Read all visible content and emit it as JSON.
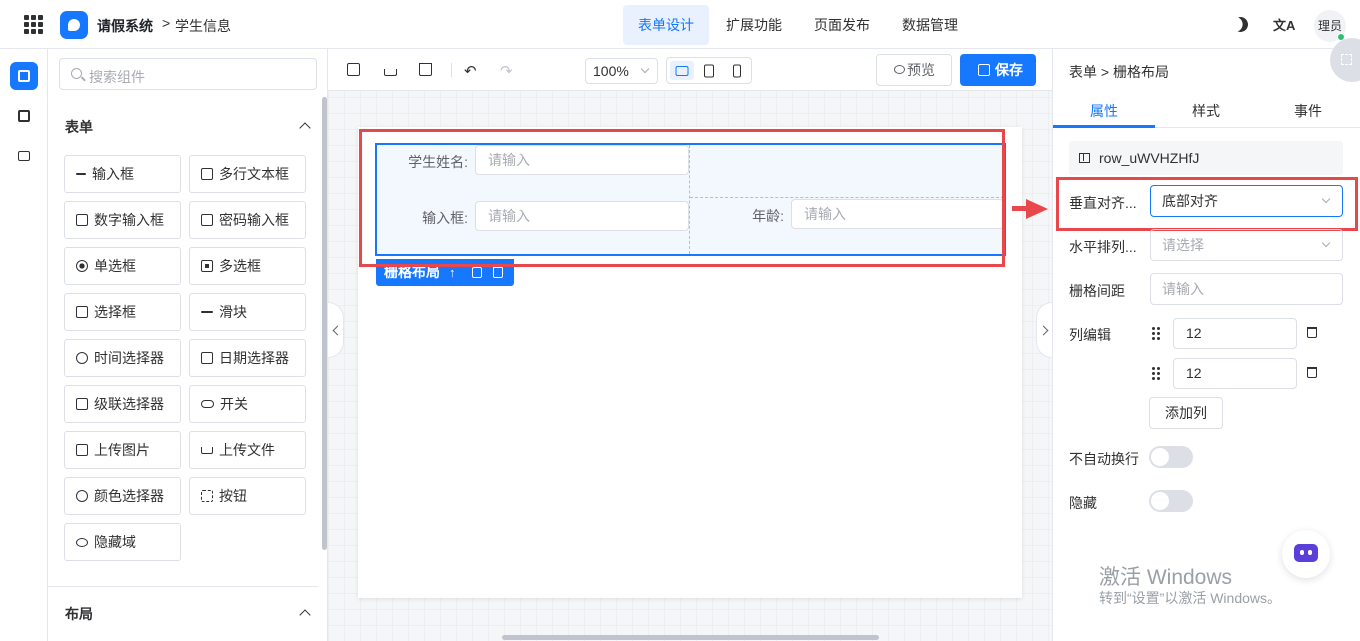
{
  "header": {
    "app_name": "请假系统",
    "breadcrumb_sep": ">",
    "page_name": "学生信息",
    "tabs": [
      {
        "label": "表单设计",
        "active": true
      },
      {
        "label": "扩展功能",
        "active": false
      },
      {
        "label": "页面发布",
        "active": false
      },
      {
        "label": "数据管理",
        "active": false
      }
    ],
    "translate_glyph": "文A",
    "avatar_text": "理员",
    "accent_color": "#1677ff"
  },
  "component_panel": {
    "search_placeholder": "搜索组件",
    "form_section_title": "表单",
    "layout_section_title": "布局",
    "components": [
      {
        "label": "输入框",
        "icon": "pencil-icon"
      },
      {
        "label": "多行文本框",
        "icon": "textarea-icon"
      },
      {
        "label": "数字输入框",
        "icon": "number-icon"
      },
      {
        "label": "密码输入框",
        "icon": "lock-icon"
      },
      {
        "label": "单选框",
        "icon": "radio-icon"
      },
      {
        "label": "多选框",
        "icon": "checkbox-icon"
      },
      {
        "label": "选择框",
        "icon": "select-icon"
      },
      {
        "label": "滑块",
        "icon": "slider-icon"
      },
      {
        "label": "时间选择器",
        "icon": "clock-icon"
      },
      {
        "label": "日期选择器",
        "icon": "calendar-icon"
      },
      {
        "label": "级联选择器",
        "icon": "cascader-icon"
      },
      {
        "label": "开关",
        "icon": "switch-icon"
      },
      {
        "label": "上传图片",
        "icon": "image-icon"
      },
      {
        "label": "上传文件",
        "icon": "upload-icon"
      },
      {
        "label": "颜色选择器",
        "icon": "palette-icon"
      },
      {
        "label": "按钮",
        "icon": "button-icon"
      },
      {
        "label": "隐藏域",
        "icon": "eye-off-icon"
      }
    ]
  },
  "toolbar": {
    "undo_glyph": "↶",
    "redo_glyph": "↷",
    "zoom_value": "100%",
    "preview_label": "预览",
    "save_label": "保存"
  },
  "canvas": {
    "fields": [
      {
        "label": "学生姓名:",
        "placeholder": "请输入"
      },
      {
        "label": "输入框:",
        "placeholder": "请输入"
      },
      {
        "label": "年龄:",
        "placeholder": "请输入"
      }
    ],
    "grid_tag_label": "栅格布局",
    "grid_tag_arrow": "↑"
  },
  "properties": {
    "breadcrumb": "表单 > 栅格布局",
    "tabs": [
      {
        "label": "属性",
        "active": true
      },
      {
        "label": "样式",
        "active": false
      },
      {
        "label": "事件",
        "active": false
      }
    ],
    "component_id": "row_uWVHZHfJ",
    "vertical_align_label": "垂直对齐...",
    "vertical_align_value": "底部对齐",
    "horizontal_label": "水平排列...",
    "horizontal_placeholder": "请选择",
    "gutter_label": "栅格间距",
    "gutter_placeholder": "请输入",
    "columns_label": "列编辑",
    "columns": [
      "12",
      "12"
    ],
    "add_column_label": "添加列",
    "nowrap_label": "不自动换行",
    "nowrap_on": false,
    "hidden_label": "隐藏",
    "hidden_on": false
  },
  "watermark": {
    "title": "激活 Windows",
    "subtitle": "转到“设置”以激活 Windows。"
  },
  "annotation_color": "#e8474c"
}
